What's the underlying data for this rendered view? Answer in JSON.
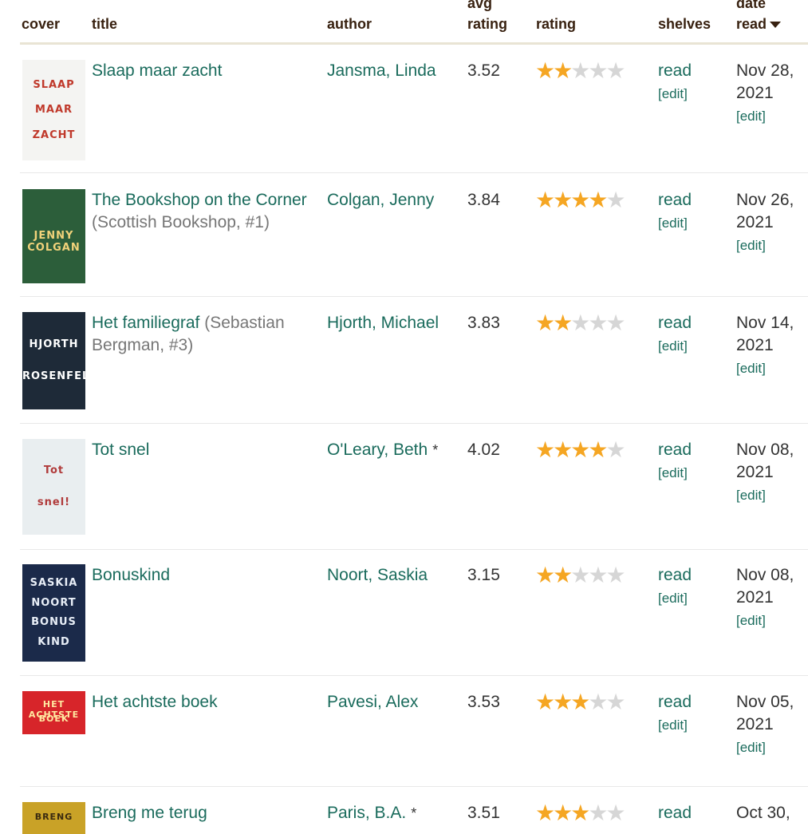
{
  "header": {
    "cover": "cover",
    "title": "title",
    "author": "author",
    "avg_line1": "avg",
    "avg_line2": "rating",
    "rating": "rating",
    "shelves": "shelves",
    "date_line1": "date",
    "date_line2": "read"
  },
  "star_symbol": "★",
  "edit_label": "[edit]",
  "books": [
    {
      "title": "Slaap maar zacht",
      "series": "",
      "author": "Jansma, Linda",
      "avg": "3.52",
      "stars": 2,
      "shelf": "read",
      "date1": "Nov 28,",
      "date2": "2021",
      "cover_bg": "#f4f4f2",
      "cover_lines": [
        "SLAAP",
        "MAAR",
        "ZACHT"
      ],
      "cover_color": "#c0392b"
    },
    {
      "title": "The Bookshop on the Corner",
      "series": "(Scottish Bookshop, #1)",
      "author": "Colgan, Jenny",
      "avg": "3.84",
      "stars": 4,
      "shelf": "read",
      "date1": "Nov 26,",
      "date2": "2021",
      "cover_bg": "#2c5e3a",
      "cover_lines": [
        "JENNY COLGAN"
      ],
      "cover_color": "#f1d27a"
    },
    {
      "title": "Het familiegraf",
      "series": "(Sebastian Bergman, #3)",
      "author": "Hjorth, Michael",
      "avg": "3.83",
      "stars": 2,
      "shelf": "read",
      "date1": "Nov 14,",
      "date2": "2021",
      "cover_bg": "#1e2a38",
      "cover_lines": [
        "HJORTH",
        "ROSENFELDT"
      ],
      "cover_color": "#ffffff"
    },
    {
      "title": "Tot snel",
      "series": "",
      "author": "O'Leary, Beth",
      "author_mark": "*",
      "avg": "4.02",
      "stars": 4,
      "shelf": "read",
      "date1": "Nov 08,",
      "date2": "2021",
      "cover_bg": "#e9eef0",
      "cover_lines": [
        "Tot",
        "snel!"
      ],
      "cover_color": "#b03a3a"
    },
    {
      "title": "Bonuskind",
      "series": "",
      "author": "Noort, Saskia",
      "avg": "3.15",
      "stars": 2,
      "shelf": "read",
      "date1": "Nov 08,",
      "date2": "2021",
      "cover_bg": "#1b2a4a",
      "cover_lines": [
        "SASKIA",
        "NOORT",
        "BONUS",
        "KIND"
      ],
      "cover_color": "#e8eef7"
    },
    {
      "title": "Het achtste boek",
      "series": "",
      "author": "Pavesi, Alex",
      "avg": "3.53",
      "stars": 3,
      "shelf": "read",
      "date1": "Nov 05,",
      "date2": "2021",
      "cover_bg": "#d7252a",
      "cover_lines": [
        "HET ACHTSTE",
        "BOEK"
      ],
      "cover_color": "#ffe8a0"
    },
    {
      "title": "Breng me terug",
      "series": "",
      "author": "Paris, B.A.",
      "author_mark": "*",
      "avg": "3.51",
      "stars": 3,
      "shelf": "read",
      "date1": "Oct 30,",
      "date2": "",
      "cover_bg": "#c9a227",
      "cover_lines": [
        "BRENG"
      ],
      "cover_color": "#3a2a10"
    }
  ]
}
